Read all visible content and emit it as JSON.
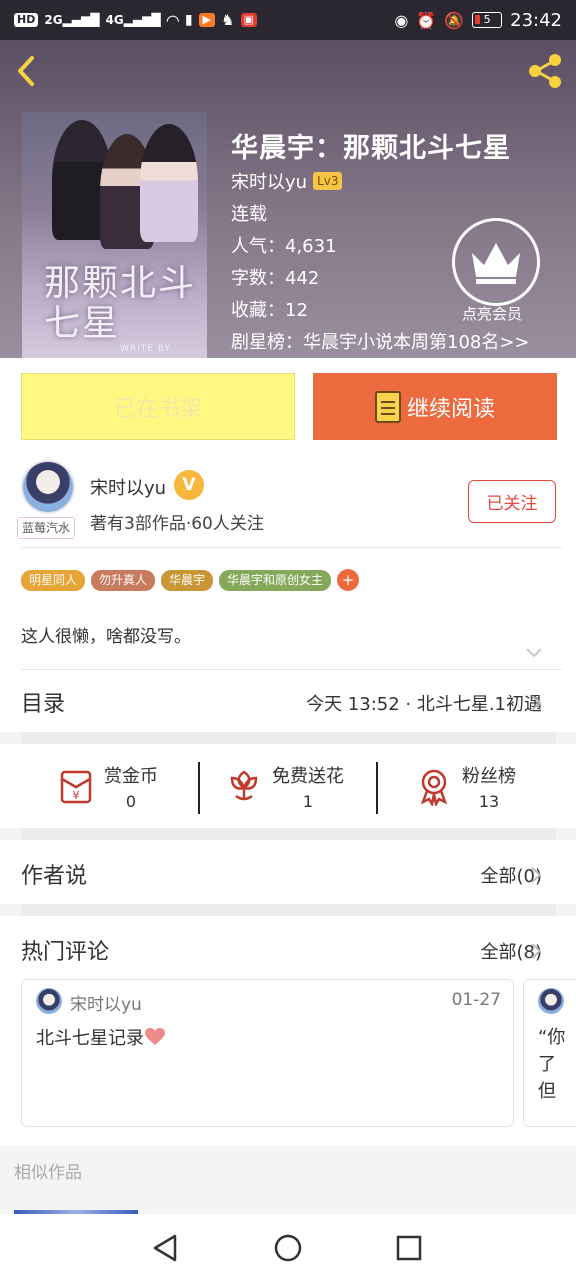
{
  "status_bar": {
    "network_label": "HD",
    "sim1": "2G",
    "sim2": "4G",
    "battery": "5",
    "time": "23:42"
  },
  "header": {
    "cover_title": "那颗北斗七星",
    "cover_subtitle": "WRITE BY",
    "title": "华晨宇：那颗北斗七星",
    "author": "宋时以yu",
    "author_level": "Lv3",
    "status": "连载",
    "popularity": "人气：4,631",
    "word_count": "字数：442",
    "favorites": "收藏：12",
    "ranking": "剧星榜：华晨宇小说本周第108名>>",
    "vip_label": "点亮会员"
  },
  "actions": {
    "shelf_label": "已在书架",
    "read_label": "继续阅读"
  },
  "author": {
    "name": "宋时以yu",
    "verified_badge": "V",
    "tag": "蓝莓汽水",
    "stats": "著有3部作品·60人关注",
    "follow_label": "已关注",
    "tags": [
      "明星同人",
      "勿升真人",
      "华晨宇",
      "华晨宇和原创女主"
    ],
    "tag_colors": [
      "#e7a437",
      "#c97b5d",
      "#c99634",
      "#86a85a"
    ],
    "bio": "这人很懒，啥都没写。"
  },
  "catalog": {
    "title": "目录",
    "latest": "今天 13:52 · 北斗七星.1初遇"
  },
  "rewards": [
    {
      "label": "赏金币",
      "value": "0",
      "icon": "red-envelope-icon"
    },
    {
      "label": "免费送花",
      "value": "1",
      "icon": "flower-icon"
    },
    {
      "label": "粉丝榜",
      "value": "13",
      "icon": "medal-icon"
    }
  ],
  "author_says": {
    "title": "作者说",
    "all": "全部(0)"
  },
  "hot_comments": {
    "title": "热门评论",
    "all": "全部(8)",
    "comment": {
      "user": "宋时以yu",
      "date": "01-27",
      "text": "北斗七星记录"
    },
    "next_preview": "“你了但"
  },
  "similar": {
    "title": "相似作品"
  },
  "colors": {
    "accent_orange": "#ec6a3e",
    "accent_yellow": "#f7d23e",
    "follow_red": "#e24a3b"
  }
}
